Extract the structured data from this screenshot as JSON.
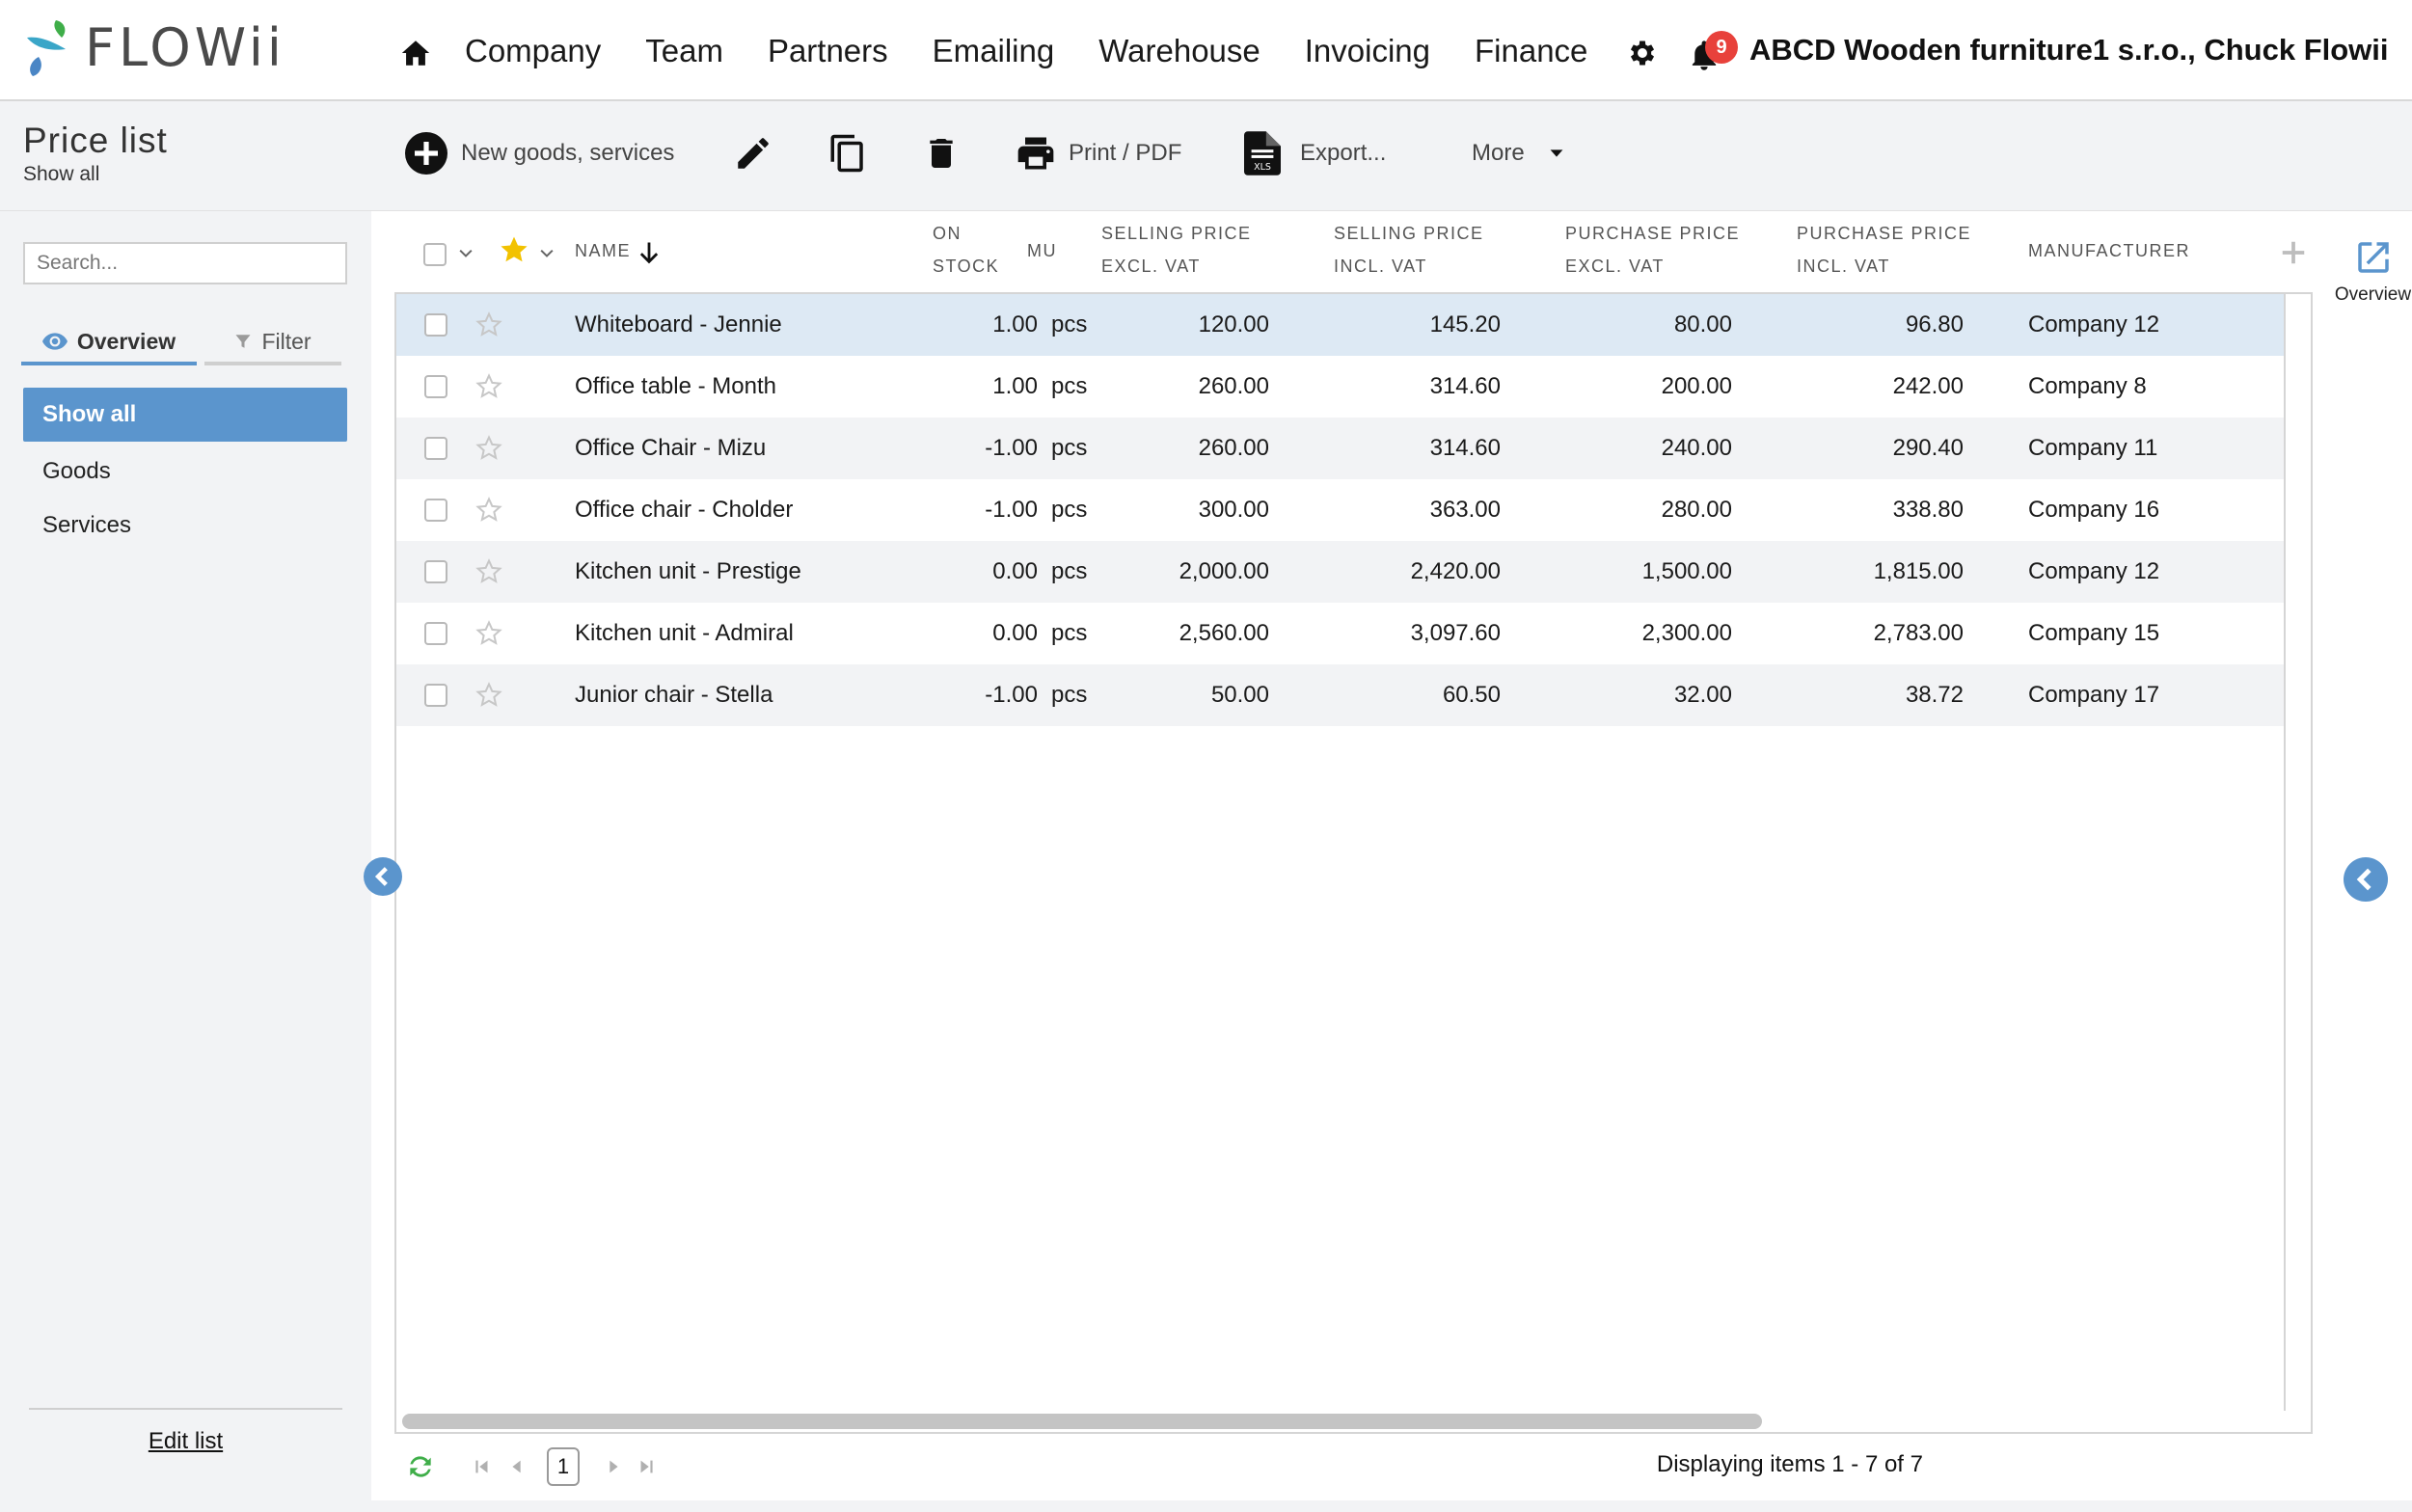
{
  "app": {
    "logo_text": "FLOWii",
    "nav": [
      "Company",
      "Team",
      "Partners",
      "Emailing",
      "Warehouse",
      "Invoicing",
      "Finance"
    ],
    "notification_count": "9",
    "account": "ABCD Wooden furniture1 s.r.o., Chuck Flowii"
  },
  "page": {
    "title": "Price list",
    "subtitle": "Show all"
  },
  "toolbar": {
    "new_label": "New goods, services",
    "print_label": "Print / PDF",
    "export_label": "Export...",
    "more_label": "More"
  },
  "sidebar": {
    "search_placeholder": "Search...",
    "tab_overview": "Overview",
    "tab_filter": "Filter",
    "items": [
      "Show all",
      "Goods",
      "Services"
    ],
    "edit_list": "Edit list"
  },
  "grid": {
    "headers": {
      "name": "NAME",
      "on_stock_1": "ON",
      "on_stock_2": "STOCK",
      "mu": "MU",
      "sell_ex_1": "SELLING PRICE",
      "sell_ex_2": "EXCL. VAT",
      "sell_in_1": "SELLING PRICE",
      "sell_in_2": "INCL. VAT",
      "purch_ex_1": "PURCHASE PRICE",
      "purch_ex_2": "EXCL. VAT",
      "purch_in_1": "PURCHASE PRICE",
      "purch_in_2": "INCL. VAT",
      "manufacturer": "MANUFACTURER"
    },
    "rows": [
      {
        "name": "Whiteboard - Jennie",
        "stock": "1.00",
        "mu": "pcs",
        "sell_ex": "120.00",
        "sell_in": "145.20",
        "purch_ex": "80.00",
        "purch_in": "96.80",
        "manufacturer": "Company 12"
      },
      {
        "name": "Office table - Month",
        "stock": "1.00",
        "mu": "pcs",
        "sell_ex": "260.00",
        "sell_in": "314.60",
        "purch_ex": "200.00",
        "purch_in": "242.00",
        "manufacturer": "Company 8"
      },
      {
        "name": "Office Chair - Mizu",
        "stock": "-1.00",
        "mu": "pcs",
        "sell_ex": "260.00",
        "sell_in": "314.60",
        "purch_ex": "240.00",
        "purch_in": "290.40",
        "manufacturer": "Company 11"
      },
      {
        "name": "Office chair - Cholder",
        "stock": "-1.00",
        "mu": "pcs",
        "sell_ex": "300.00",
        "sell_in": "363.00",
        "purch_ex": "280.00",
        "purch_in": "338.80",
        "manufacturer": "Company 16"
      },
      {
        "name": "Kitchen unit - Prestige",
        "stock": "0.00",
        "mu": "pcs",
        "sell_ex": "2,000.00",
        "sell_in": "2,420.00",
        "purch_ex": "1,500.00",
        "purch_in": "1,815.00",
        "manufacturer": "Company 12"
      },
      {
        "name": "Kitchen unit - Admiral",
        "stock": "0.00",
        "mu": "pcs",
        "sell_ex": "2,560.00",
        "sell_in": "3,097.60",
        "purch_ex": "2,300.00",
        "purch_in": "2,783.00",
        "manufacturer": "Company 15"
      },
      {
        "name": "Junior chair - Stella",
        "stock": "-1.00",
        "mu": "pcs",
        "sell_ex": "50.00",
        "sell_in": "60.50",
        "purch_ex": "32.00",
        "purch_in": "38.72",
        "manufacturer": "Company 17"
      }
    ]
  },
  "right_panel": {
    "overview_label": "Overview"
  },
  "pager": {
    "page": "1",
    "info": "Displaying items 1 - 7 of 7"
  },
  "colors": {
    "accent": "#5b95cd",
    "badge": "#e8413b",
    "star": "#f2c200",
    "refresh": "#3fae49"
  }
}
